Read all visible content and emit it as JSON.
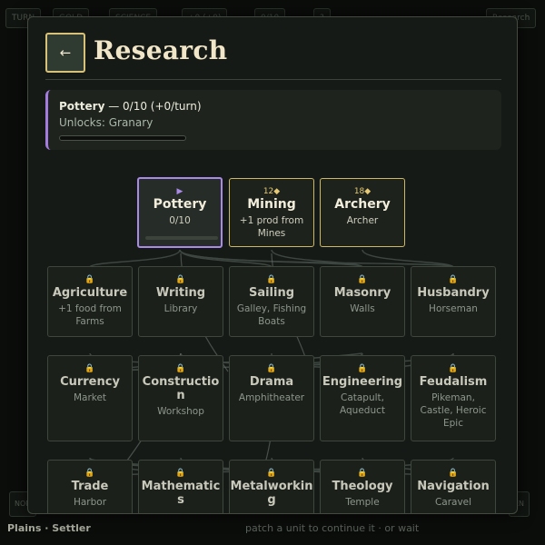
{
  "modal": {
    "back_icon": "←",
    "title": "Research"
  },
  "current_research": {
    "name": "Pottery",
    "progress_text": " — 0/10 (+0/turn)",
    "unlocks": "Unlocks: Granary",
    "progress_fraction": 0.0,
    "accent_color": "#a47ce0"
  },
  "tree": {
    "row1": [
      {
        "name": "Pottery",
        "icon": "▶",
        "state": "active",
        "detail": "0/10",
        "progress_fraction": 0.0
      },
      {
        "name": "Mining",
        "icon": "12◆",
        "state": "available",
        "detail": "+1 prod from Mines"
      },
      {
        "name": "Archery",
        "icon": "18◆",
        "state": "available",
        "detail": "Archer"
      }
    ],
    "row2": [
      {
        "name": "Agriculture",
        "icon": "🔒",
        "state": "locked",
        "detail": "+1 food from Farms"
      },
      {
        "name": "Writing",
        "icon": "🔒",
        "state": "locked",
        "detail": "Library"
      },
      {
        "name": "Sailing",
        "icon": "🔒",
        "state": "locked",
        "detail": "Galley, Fishing Boats"
      },
      {
        "name": "Masonry",
        "icon": "🔒",
        "state": "locked",
        "detail": "Walls"
      },
      {
        "name": "Husbandry",
        "icon": "🔒",
        "state": "locked",
        "detail": "Horseman"
      }
    ],
    "row3": [
      {
        "name": "Currency",
        "icon": "🔒",
        "state": "locked",
        "detail": "Market"
      },
      {
        "name": "Construction",
        "icon": "🔒",
        "state": "locked",
        "detail": "Workshop"
      },
      {
        "name": "Drama",
        "icon": "🔒",
        "state": "locked",
        "detail": "Amphitheater"
      },
      {
        "name": "Engineering",
        "icon": "🔒",
        "state": "locked",
        "detail": "Catapult, Aqueduct"
      },
      {
        "name": "Feudalism",
        "icon": "🔒",
        "state": "locked",
        "detail": "Pikeman, Castle, Heroic Epic"
      }
    ],
    "row4": [
      {
        "name": "Trade",
        "icon": "🔒",
        "state": "locked",
        "detail": "Harbor"
      },
      {
        "name": "Mathematics",
        "icon": "🔒",
        "state": "locked",
        "detail": ""
      },
      {
        "name": "Metalworking",
        "icon": "🔒",
        "state": "locked",
        "detail": ""
      },
      {
        "name": "Theology",
        "icon": "🔒",
        "state": "locked",
        "detail": "Temple"
      },
      {
        "name": "Navigation",
        "icon": "🔒",
        "state": "locked",
        "detail": "Caravel"
      }
    ]
  },
  "background": {
    "top_chips": [
      "TURN",
      "GOLD",
      "SCIENCE",
      "+0 (+0)",
      "0/10",
      "?",
      "Research"
    ],
    "bottom_chips": [
      "NOR",
      "",
      "",
      "",
      "",
      "",
      "",
      "EN"
    ],
    "bottom_left": "Plains · Settler",
    "bottom_right": "patch a unit to continue it · or wait"
  }
}
